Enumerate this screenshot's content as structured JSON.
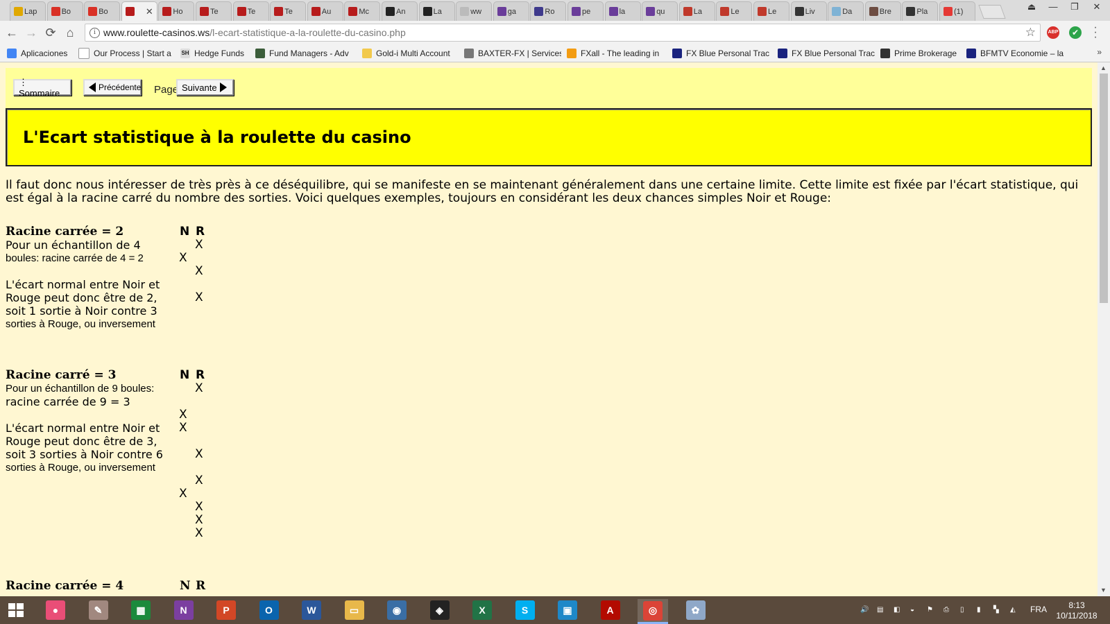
{
  "browser": {
    "tabs": [
      {
        "label": "Lap",
        "color": "#e0a800"
      },
      {
        "label": "Bo",
        "color": "#d93025"
      },
      {
        "label": "Bo",
        "color": "#d93025"
      },
      {
        "label": "",
        "color": "#b71c1c",
        "active": true
      },
      {
        "label": "Ho",
        "color": "#b71c1c"
      },
      {
        "label": "Te",
        "color": "#b71c1c"
      },
      {
        "label": "Te",
        "color": "#b71c1c"
      },
      {
        "label": "Te",
        "color": "#b71c1c"
      },
      {
        "label": "Au",
        "color": "#b71c1c"
      },
      {
        "label": "Mc",
        "color": "#b71c1c"
      },
      {
        "label": "An",
        "color": "#222222"
      },
      {
        "label": "La",
        "color": "#222222"
      },
      {
        "label": "ww",
        "color": "#bbbbbb"
      },
      {
        "label": "ga",
        "color": "#6a3d9a"
      },
      {
        "label": "Ro",
        "color": "#3f3a8c"
      },
      {
        "label": "pe",
        "color": "#6a3d9a"
      },
      {
        "label": "la",
        "color": "#6a3d9a"
      },
      {
        "label": "qu",
        "color": "#6a3d9a"
      },
      {
        "label": "La",
        "color": "#c0392b"
      },
      {
        "label": "Le",
        "color": "#c0392b"
      },
      {
        "label": "Le",
        "color": "#c0392b"
      },
      {
        "label": "Liv",
        "color": "#333333"
      },
      {
        "label": "Da",
        "color": "#7fb3d5"
      },
      {
        "label": "Bre",
        "color": "#6d4c41"
      },
      {
        "label": "Pla",
        "color": "#333333"
      },
      {
        "label": "(1)",
        "color": "#e53935"
      }
    ],
    "tab_close": "✕",
    "window_controls": {
      "user": "⏏",
      "minimize": "—",
      "restore": "❐",
      "close": "✕"
    },
    "nav": {
      "back": "←",
      "forward": "→",
      "reload": "⟳",
      "home": "⌂"
    },
    "address": {
      "host": "www.roulette-casinos.ws",
      "path": "/l-ecart-statistique-a-la-roulette-du-casino.php",
      "info_icon": "i",
      "bookmark_star": "☆"
    },
    "extensions": {
      "abp": "ABP",
      "check": "✔"
    },
    "bookmarks": [
      {
        "label": "Aplicaciones",
        "color": "#4285f4"
      },
      {
        "label": "Our Process | Start a",
        "color": "#ffffff"
      },
      {
        "label": "Hedge Funds",
        "color": "#dddddd",
        "icon_text": "SH"
      },
      {
        "label": "Fund Managers - Adv",
        "color": "#3b5d3a"
      },
      {
        "label": "Gold-i Multi Account",
        "color": "#f2c94c"
      },
      {
        "label": "BAXTER-FX | Services",
        "color": "#777777"
      },
      {
        "label": "FXall - The leading in",
        "color": "#f39c12"
      },
      {
        "label": "FX Blue Personal Trac",
        "color": "#1a237e"
      },
      {
        "label": "FX Blue Personal Trac",
        "color": "#1a237e"
      },
      {
        "label": "Prime Brokerage",
        "color": "#333333"
      },
      {
        "label": "BFMTV Economie – la",
        "color": "#1a237e"
      }
    ],
    "bookmarks_more": "»"
  },
  "page": {
    "buttons": {
      "sommaire": "⋮ Sommaire",
      "precedente": "Précédente",
      "page": "Page",
      "suivante": "Suivante"
    },
    "title": "L'Ecart statistique à la roulette du casino",
    "intro": "Il faut donc nous intéresser de très près à ce déséquilibre, qui se manifeste en se maintenant généralement dans une certaine limite. Cette limite est fixée par l'écart statistique, qui est égal à la racine carré du nombre des sorties. Voici quelques exemples, toujours en considérant les deux chances simples Noir et Rouge:",
    "col_n": "N",
    "col_r": "R",
    "mark": "X",
    "sections": [
      {
        "title": "Racine carrée = 2",
        "lines": [
          {
            "text": "Pour un échantillon de 4",
            "style": "a"
          },
          {
            "text": "boules: racine carrée de 4 = 2",
            "style": "b"
          },
          {
            "text": "",
            "style": "a"
          },
          {
            "text": "L'écart normal entre Noir et",
            "style": "a"
          },
          {
            "text": "Rouge peut donc être de 2,",
            "style": "a"
          },
          {
            "text": "soit 1 sortie à Noir contre 3",
            "style": "a"
          },
          {
            "text": "sorties à Rouge, ou inversement",
            "style": "b"
          }
        ],
        "marks": [
          "R",
          "N",
          "R",
          "",
          "R"
        ]
      },
      {
        "title": "Racine carré = 3",
        "lines": [
          {
            "text": "Pour un échantillon de 9 boules:",
            "style": "b"
          },
          {
            "text": "racine carrée de 9 = 3",
            "style": "a"
          },
          {
            "text": "",
            "style": "a"
          },
          {
            "text": "L'écart normal entre Noir et",
            "style": "a"
          },
          {
            "text": "Rouge peut donc être de 3,",
            "style": "a"
          },
          {
            "text": "soit 3 sorties à Noir contre 6",
            "style": "a"
          },
          {
            "text": "sorties à Rouge, ou inversement",
            "style": "b"
          }
        ],
        "marks": [
          "R",
          "",
          "N",
          "N",
          "",
          "R",
          "",
          "R",
          "N",
          "R",
          "R",
          "R"
        ]
      }
    ],
    "next_section_title": "Racine carrée = 4"
  },
  "scrollbar": {
    "up": "▲",
    "down": "▼"
  },
  "taskbar": {
    "apps": [
      {
        "name": "paint-app-icon",
        "color": "#e94e77",
        "glyph": "●"
      },
      {
        "name": "notepad-app-icon",
        "color": "#a1887f",
        "glyph": "✎"
      },
      {
        "name": "store-app-icon",
        "color": "#1b8a3c",
        "glyph": "▦"
      },
      {
        "name": "onenote-app-icon",
        "color": "#7b3fa0",
        "glyph": "N"
      },
      {
        "name": "powerpoint-app-icon",
        "color": "#d24726",
        "glyph": "P"
      },
      {
        "name": "outlook-app-icon",
        "color": "#0a64ad",
        "glyph": "O"
      },
      {
        "name": "word-app-icon",
        "color": "#2b579a",
        "glyph": "W"
      },
      {
        "name": "explorer-app-icon",
        "color": "#e8b84a",
        "glyph": "▭"
      },
      {
        "name": "owl-app-icon",
        "color": "#3a6ea5",
        "glyph": "◉"
      },
      {
        "name": "fox-app-icon",
        "color": "#222222",
        "glyph": "◈"
      },
      {
        "name": "excel-app-icon",
        "color": "#217346",
        "glyph": "X"
      },
      {
        "name": "skype-app-icon",
        "color": "#00aff0",
        "glyph": "S"
      },
      {
        "name": "network-app-icon",
        "color": "#1e88c8",
        "glyph": "▣"
      },
      {
        "name": "acrobat-app-icon",
        "color": "#b30b00",
        "glyph": "A"
      },
      {
        "name": "chrome-app-icon",
        "color": "#db4437",
        "glyph": "◎",
        "active": true
      },
      {
        "name": "paint3d-app-icon",
        "color": "#8fa8c8",
        "glyph": "✿"
      }
    ],
    "tray": [
      "🔊",
      "▤",
      "◧",
      "◒",
      "⚑",
      "⎙",
      "▯",
      "▮",
      "▚",
      "◭"
    ],
    "lang": "FRA",
    "time": "8:13",
    "date": "10/11/2018"
  }
}
